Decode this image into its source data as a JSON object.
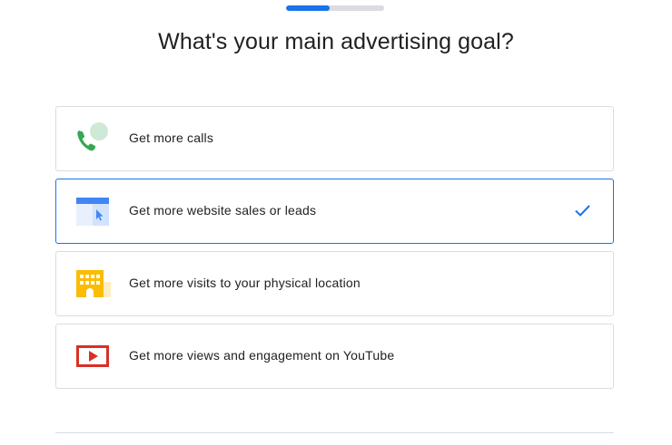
{
  "progress": {
    "fraction": 0.44
  },
  "title": "What's your main advertising goal?",
  "colors": {
    "accent": "#1a73e8",
    "phone_green": "#34a853",
    "store_yellow": "#fbbc04",
    "youtube_red": "#d93025"
  },
  "options": [
    {
      "label": "Get more calls",
      "icon": "phone-icon",
      "selected": false
    },
    {
      "label": "Get more website sales or leads",
      "icon": "website-icon",
      "selected": true
    },
    {
      "label": "Get more visits to your physical location",
      "icon": "storefront-icon",
      "selected": false
    },
    {
      "label": "Get more views and engagement on YouTube",
      "icon": "youtube-play-icon",
      "selected": false
    }
  ]
}
